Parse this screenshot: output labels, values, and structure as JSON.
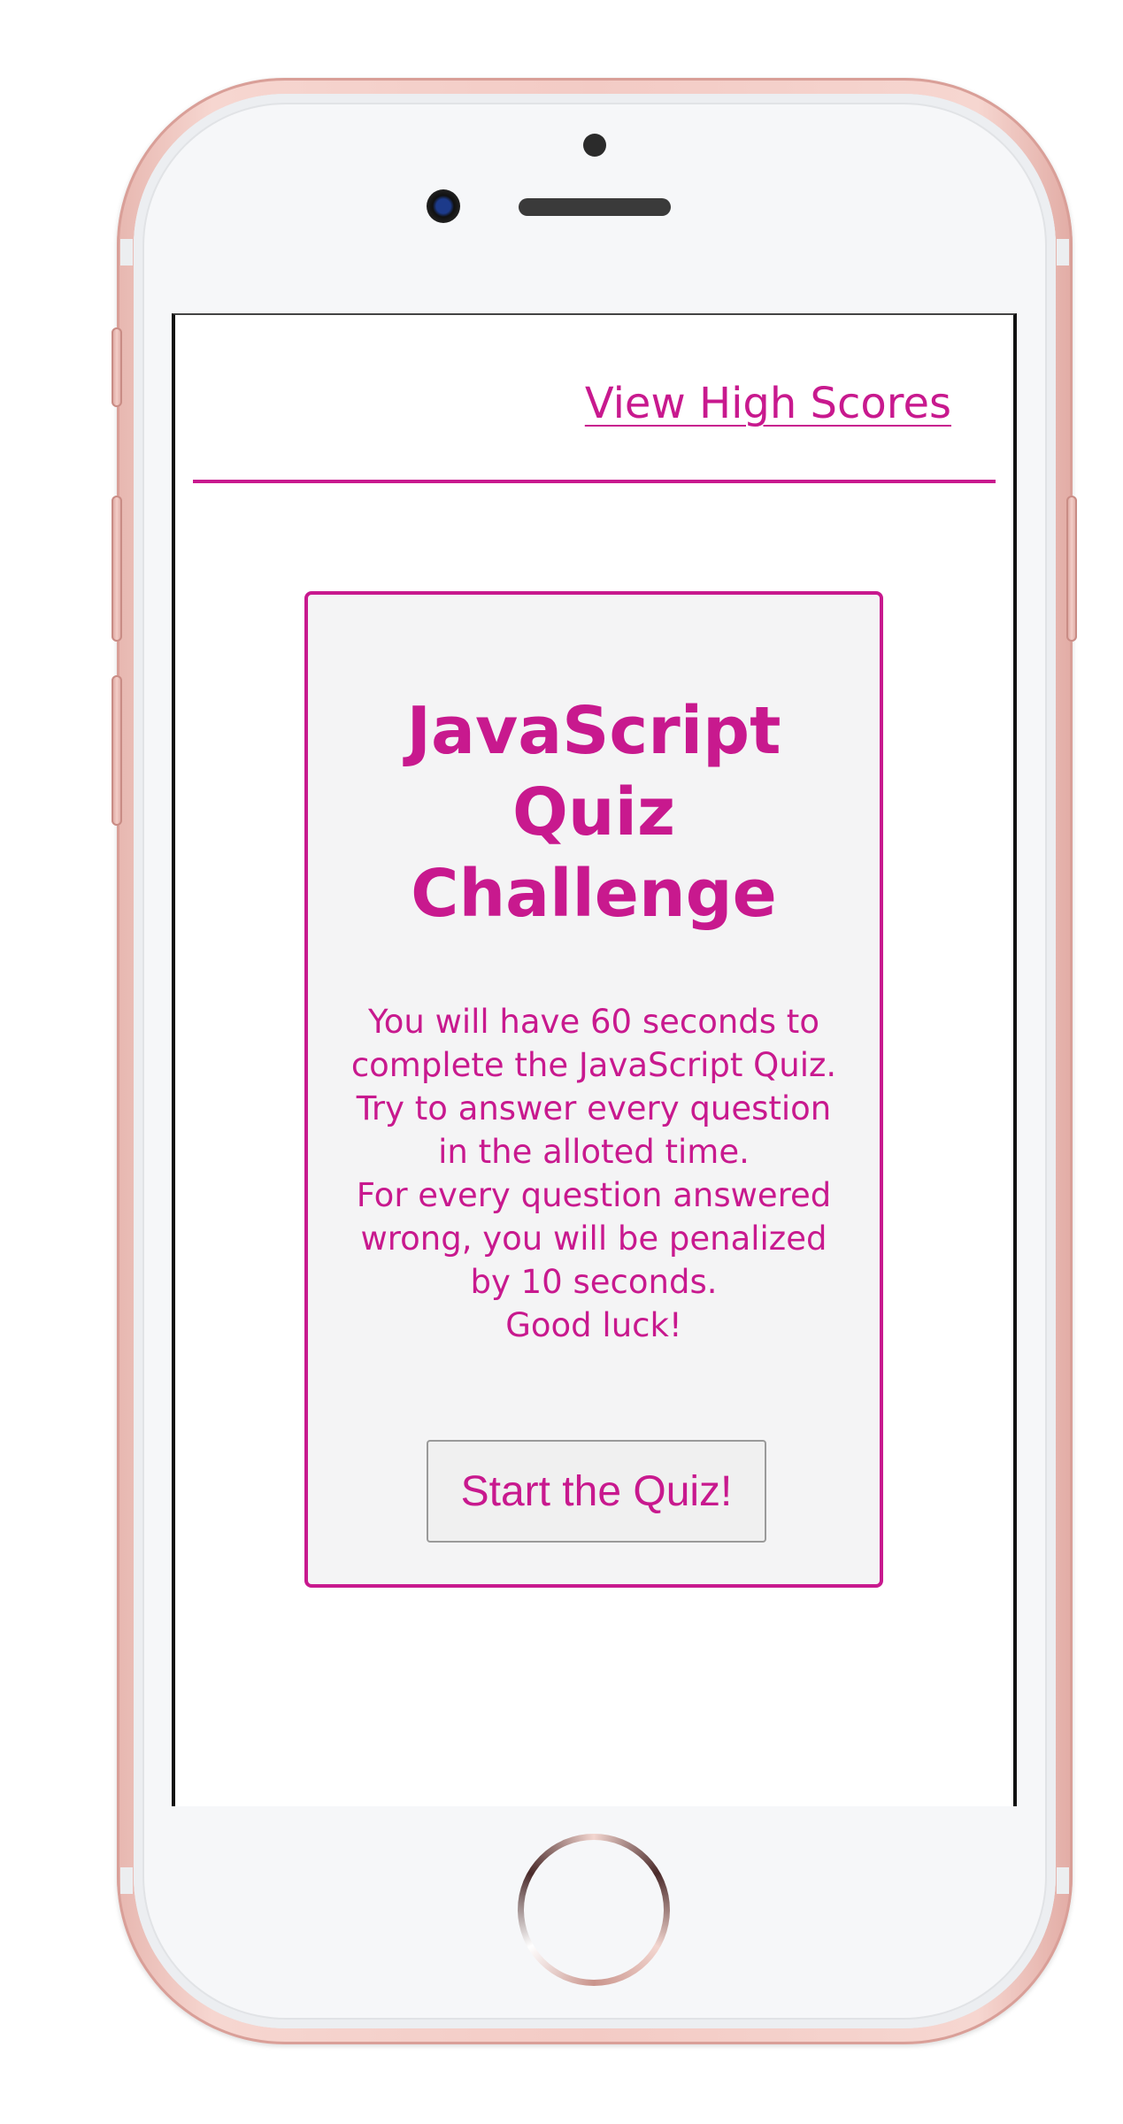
{
  "header": {
    "high_scores_link": "View High Scores"
  },
  "quiz": {
    "title_lines": [
      "JavaScript",
      "Quiz",
      "Challenge"
    ],
    "instruction_lines": [
      "You will have 60 seconds to",
      "complete the JavaScript Quiz.",
      "Try to answer every question",
      "in the alloted time.",
      "For every question answered",
      "wrong, you will be penalized",
      "by 10 seconds.",
      "Good luck!"
    ],
    "start_button_label": "Start the Quiz!"
  },
  "colors": {
    "accent": "#c8198e",
    "card_background": "#f4f4f5",
    "phone_frame": "#f3cbc5"
  }
}
